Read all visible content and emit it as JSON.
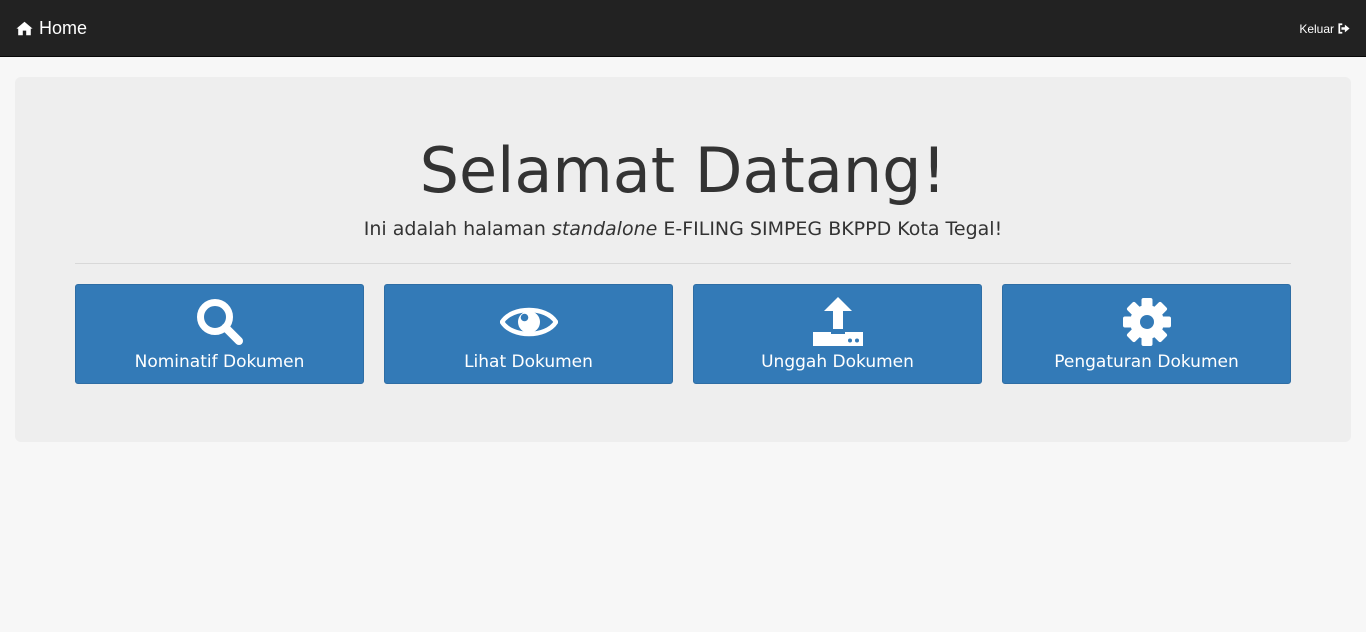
{
  "navbar": {
    "brand_label": "Home",
    "brand_icon": "home-icon",
    "logout_label": "Keluar",
    "logout_icon": "sign-out-icon"
  },
  "jumbotron": {
    "title": "Selamat Datang!",
    "subtitle_before": "Ini adalah halaman ",
    "subtitle_emphasis": "standalone",
    "subtitle_after": " E-FILING SIMPEG BKPPD Kota Tegal!"
  },
  "tiles": [
    {
      "label": "Nominatif Dokumen",
      "icon": "search-icon"
    },
    {
      "label": "Lihat Dokumen",
      "icon": "eye-icon"
    },
    {
      "label": "Unggah Dokumen",
      "icon": "upload-icon"
    },
    {
      "label": "Pengaturan Dokumen",
      "icon": "gear-icon"
    }
  ],
  "colors": {
    "navbar_bg": "#222222",
    "page_bg": "#f7f7f7",
    "jumbotron_bg": "#eeeeee",
    "tile_bg": "#337ab7",
    "text": "#333333"
  }
}
